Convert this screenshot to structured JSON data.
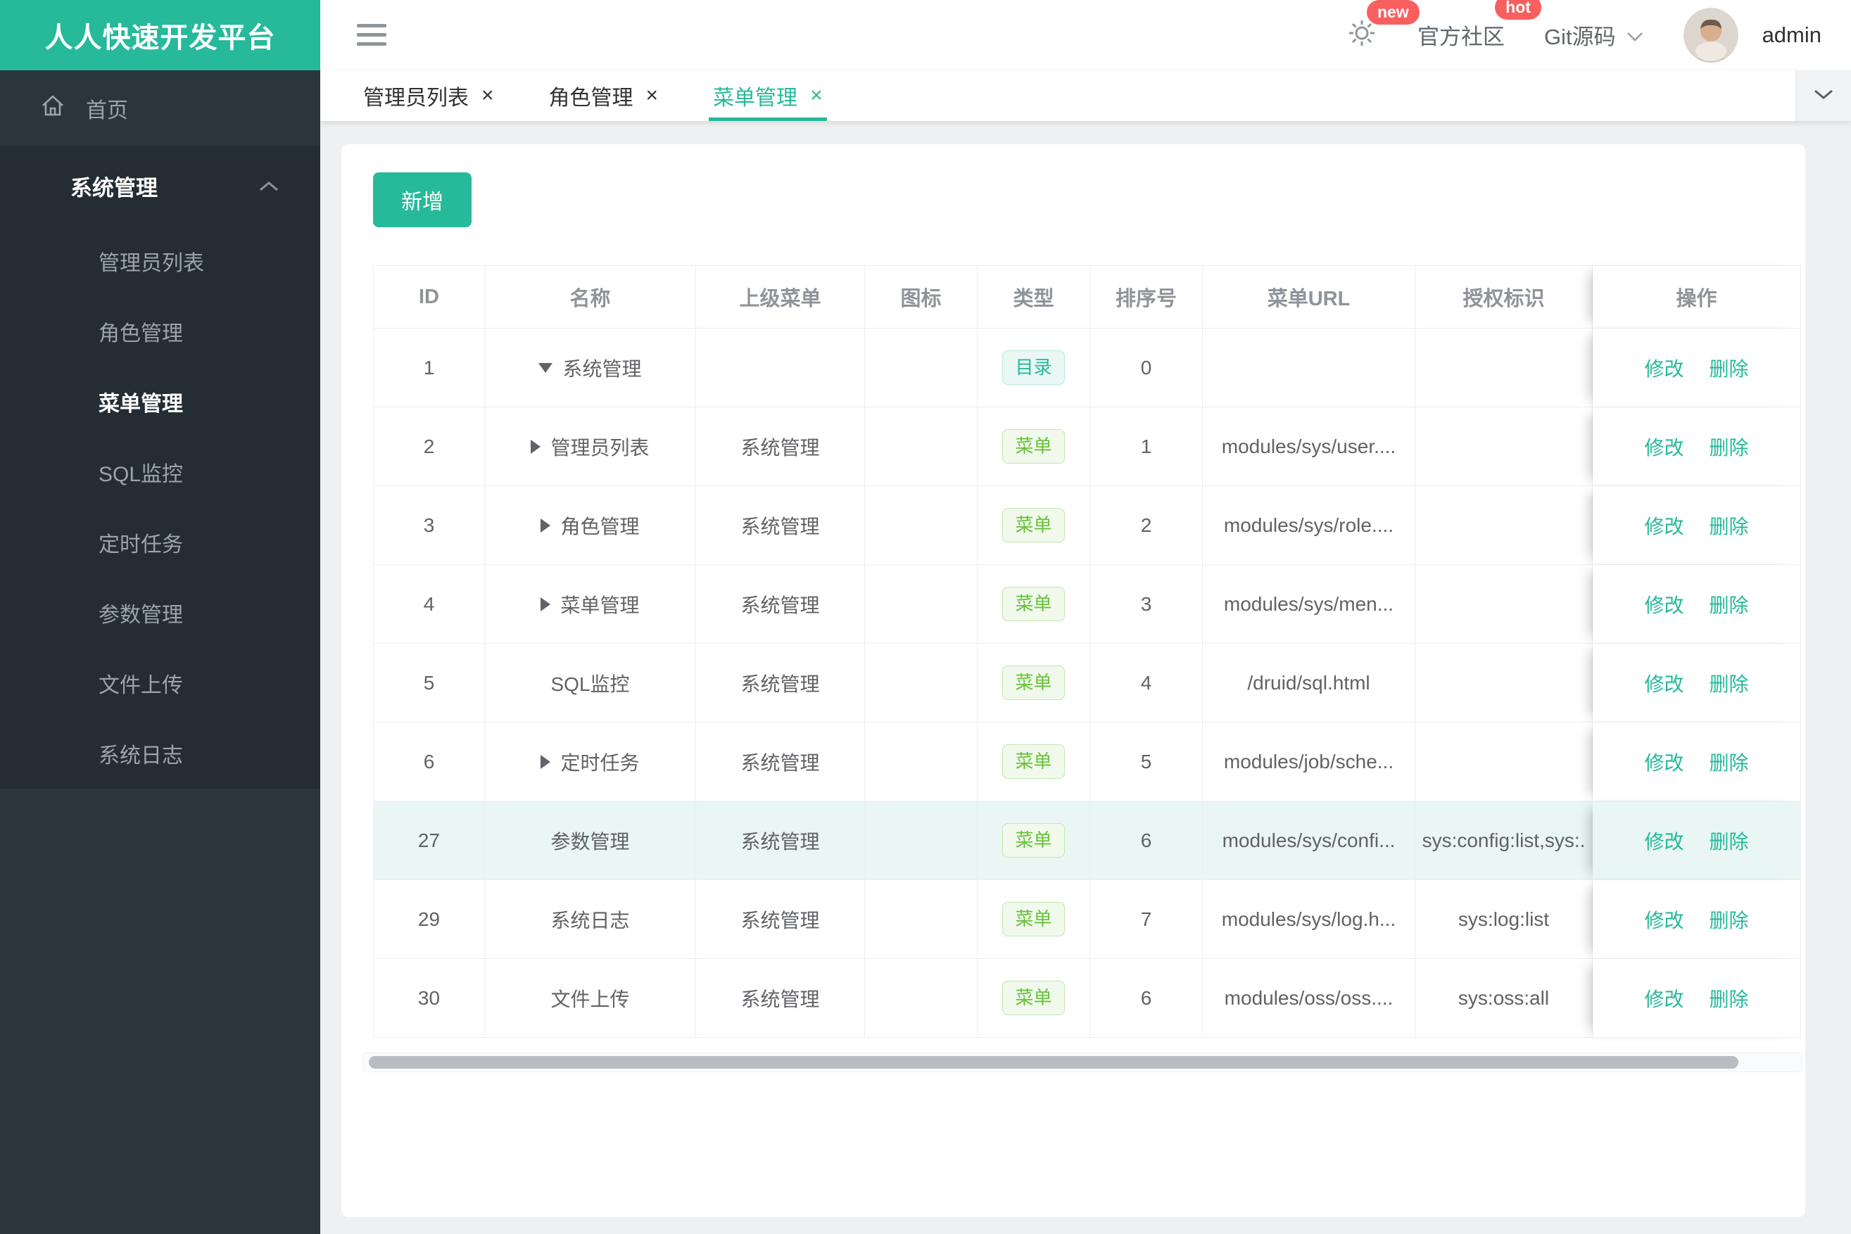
{
  "app": {
    "title": "人人快速开发平台"
  },
  "topbar": {
    "gear_badge": "new",
    "community_label": "官方社区",
    "community_badge": "hot",
    "git_label": "Git源码",
    "username": "admin"
  },
  "tabs": [
    {
      "label": "管理员列表",
      "active": false
    },
    {
      "label": "角色管理",
      "active": false
    },
    {
      "label": "菜单管理",
      "active": true
    }
  ],
  "sidebar": {
    "home_label": "首页",
    "group_label": "系统管理",
    "items": [
      {
        "label": "管理员列表",
        "active": false
      },
      {
        "label": "角色管理",
        "active": false
      },
      {
        "label": "菜单管理",
        "active": true
      },
      {
        "label": "SQL监控",
        "active": false
      },
      {
        "label": "定时任务",
        "active": false
      },
      {
        "label": "参数管理",
        "active": false
      },
      {
        "label": "文件上传",
        "active": false
      },
      {
        "label": "系统日志",
        "active": false
      }
    ]
  },
  "toolbar": {
    "add_label": "新增"
  },
  "table": {
    "headers": [
      "ID",
      "名称",
      "上级菜单",
      "图标",
      "类型",
      "排序号",
      "菜单URL",
      "授权标识",
      "操作"
    ],
    "actions": {
      "edit": "修改",
      "delete": "删除"
    },
    "rows": [
      {
        "id": "1",
        "arrow": "down",
        "name": "系统管理",
        "parent": "",
        "icon": "",
        "type": "目录",
        "type_kind": "dir",
        "sort": "0",
        "url": "",
        "perms": "",
        "highlight": false
      },
      {
        "id": "2",
        "arrow": "right",
        "name": "管理员列表",
        "parent": "系统管理",
        "icon": "",
        "type": "菜单",
        "type_kind": "menu",
        "sort": "1",
        "url": "modules/sys/user....",
        "perms": "",
        "highlight": false
      },
      {
        "id": "3",
        "arrow": "right",
        "name": "角色管理",
        "parent": "系统管理",
        "icon": "",
        "type": "菜单",
        "type_kind": "menu",
        "sort": "2",
        "url": "modules/sys/role....",
        "perms": "",
        "highlight": false
      },
      {
        "id": "4",
        "arrow": "right",
        "name": "菜单管理",
        "parent": "系统管理",
        "icon": "",
        "type": "菜单",
        "type_kind": "menu",
        "sort": "3",
        "url": "modules/sys/men...",
        "perms": "",
        "highlight": false
      },
      {
        "id": "5",
        "arrow": "none",
        "name": "SQL监控",
        "parent": "系统管理",
        "icon": "",
        "type": "菜单",
        "type_kind": "menu",
        "sort": "4",
        "url": "/druid/sql.html",
        "perms": "",
        "highlight": false
      },
      {
        "id": "6",
        "arrow": "right",
        "name": "定时任务",
        "parent": "系统管理",
        "icon": "",
        "type": "菜单",
        "type_kind": "menu",
        "sort": "5",
        "url": "modules/job/sche...",
        "perms": "",
        "highlight": false
      },
      {
        "id": "27",
        "arrow": "none",
        "name": "参数管理",
        "parent": "系统管理",
        "icon": "",
        "type": "菜单",
        "type_kind": "menu",
        "sort": "6",
        "url": "modules/sys/confi...",
        "perms": "sys:config:list,sys:.",
        "highlight": true
      },
      {
        "id": "29",
        "arrow": "none",
        "name": "系统日志",
        "parent": "系统管理",
        "icon": "",
        "type": "菜单",
        "type_kind": "menu",
        "sort": "7",
        "url": "modules/sys/log.h...",
        "perms": "sys:log:list",
        "highlight": false
      },
      {
        "id": "30",
        "arrow": "none",
        "name": "文件上传",
        "parent": "系统管理",
        "icon": "",
        "type": "菜单",
        "type_kind": "menu",
        "sort": "6",
        "url": "modules/oss/oss....",
        "perms": "sys:oss:all",
        "highlight": false
      }
    ]
  },
  "colors": {
    "primary": "#26b99a",
    "badge_red": "#f95f5f",
    "tag_dir": "#26b99a",
    "tag_menu": "#67c23a",
    "row_highlight": "#e9f6f3",
    "sidebar_bg": "#2b353c",
    "sidebar_submenu_bg": "#232d33"
  }
}
